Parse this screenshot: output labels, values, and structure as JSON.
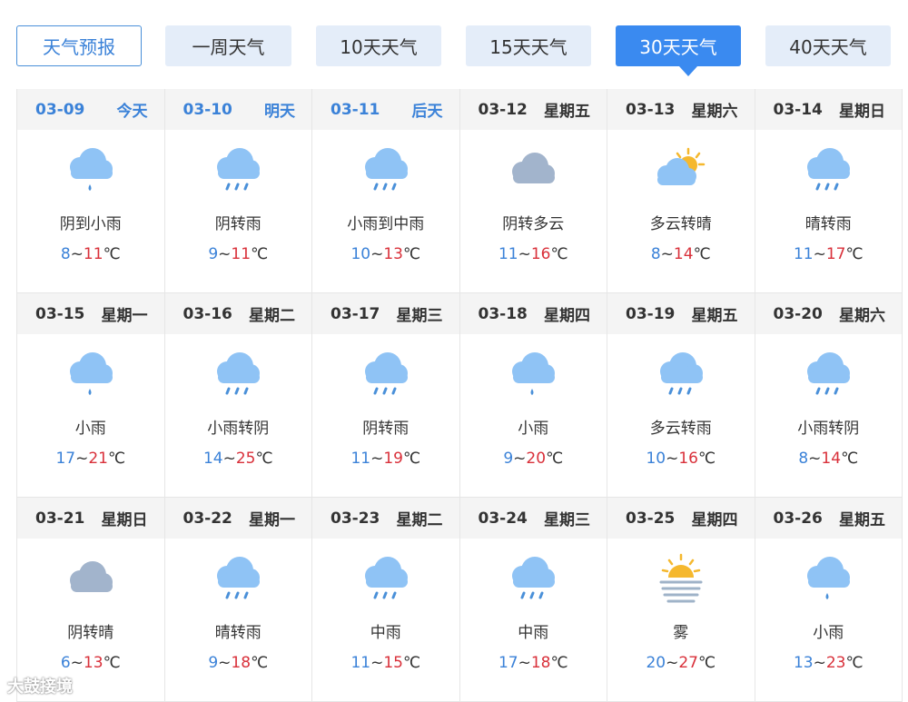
{
  "tabs": [
    {
      "label": "天气预报"
    },
    {
      "label": "一周天气"
    },
    {
      "label": "10天天气"
    },
    {
      "label": "15天天气"
    },
    {
      "label": "30天天气"
    },
    {
      "label": "40天天气"
    }
  ],
  "selected_tab": "30天天气",
  "days": [
    {
      "date": "03-09",
      "day": "今天",
      "icon": "light-rain-icon",
      "desc": "阴到小雨",
      "lo": "8",
      "hi": "11"
    },
    {
      "date": "03-10",
      "day": "明天",
      "icon": "rain-icon",
      "desc": "阴转雨",
      "lo": "9",
      "hi": "11"
    },
    {
      "date": "03-11",
      "day": "后天",
      "icon": "rain-icon",
      "desc": "小雨到中雨",
      "lo": "10",
      "hi": "13"
    },
    {
      "date": "03-12",
      "day": "星期五",
      "icon": "overcast-icon",
      "desc": "阴转多云",
      "lo": "11",
      "hi": "16"
    },
    {
      "date": "03-13",
      "day": "星期六",
      "icon": "partly-sunny-icon",
      "desc": "多云转晴",
      "lo": "8",
      "hi": "14"
    },
    {
      "date": "03-14",
      "day": "星期日",
      "icon": "rain-icon",
      "desc": "晴转雨",
      "lo": "11",
      "hi": "17"
    },
    {
      "date": "03-15",
      "day": "星期一",
      "icon": "light-rain-icon",
      "desc": "小雨",
      "lo": "17",
      "hi": "21"
    },
    {
      "date": "03-16",
      "day": "星期二",
      "icon": "rain-icon",
      "desc": "小雨转阴",
      "lo": "14",
      "hi": "25"
    },
    {
      "date": "03-17",
      "day": "星期三",
      "icon": "rain-icon",
      "desc": "阴转雨",
      "lo": "11",
      "hi": "19"
    },
    {
      "date": "03-18",
      "day": "星期四",
      "icon": "light-rain-icon",
      "desc": "小雨",
      "lo": "9",
      "hi": "20"
    },
    {
      "date": "03-19",
      "day": "星期五",
      "icon": "rain-icon",
      "desc": "多云转雨",
      "lo": "10",
      "hi": "16"
    },
    {
      "date": "03-20",
      "day": "星期六",
      "icon": "rain-icon",
      "desc": "小雨转阴",
      "lo": "8",
      "hi": "14"
    },
    {
      "date": "03-21",
      "day": "星期日",
      "icon": "overcast-icon",
      "desc": "阴转晴",
      "lo": "6",
      "hi": "13"
    },
    {
      "date": "03-22",
      "day": "星期一",
      "icon": "rain-icon",
      "desc": "晴转雨",
      "lo": "9",
      "hi": "18"
    },
    {
      "date": "03-23",
      "day": "星期二",
      "icon": "rain-icon",
      "desc": "中雨",
      "lo": "11",
      "hi": "15"
    },
    {
      "date": "03-24",
      "day": "星期三",
      "icon": "rain-icon",
      "desc": "中雨",
      "lo": "17",
      "hi": "18"
    },
    {
      "date": "03-25",
      "day": "星期四",
      "icon": "fog-icon",
      "desc": "雾",
      "lo": "20",
      "hi": "27"
    },
    {
      "date": "03-26",
      "day": "星期五",
      "icon": "light-rain-icon",
      "desc": "小雨",
      "lo": "13",
      "hi": "23"
    }
  ],
  "unit": "℃",
  "separator": "~",
  "watermark": "大鼓接境",
  "colors": {
    "accent": "#3a8af0",
    "low_temp": "#3b82d8",
    "high_temp": "#d9303a",
    "cloud_blue": "#8fc3f5",
    "cloud_gray": "#a2b4cc",
    "sun": "#f5b82e"
  }
}
